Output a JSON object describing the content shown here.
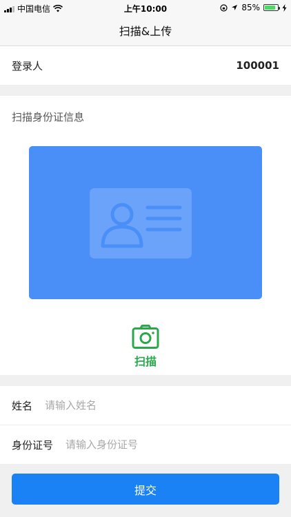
{
  "status_bar": {
    "carrier": "中国电信",
    "time": "上午10:00",
    "battery": "85%"
  },
  "nav": {
    "title": "扫描&上传"
  },
  "login": {
    "label": "登录人",
    "value": "100001"
  },
  "scan": {
    "section_title": "扫描身份证信息",
    "button_label": "扫描",
    "accent_color": "#29a84a",
    "card_color": "#4a8ff8"
  },
  "form": {
    "name_label": "姓名",
    "name_placeholder": "请输入姓名",
    "id_label": "身份证号",
    "id_placeholder": "请输入身份证号"
  },
  "submit": {
    "label": "提交",
    "color": "#1a82f5"
  }
}
